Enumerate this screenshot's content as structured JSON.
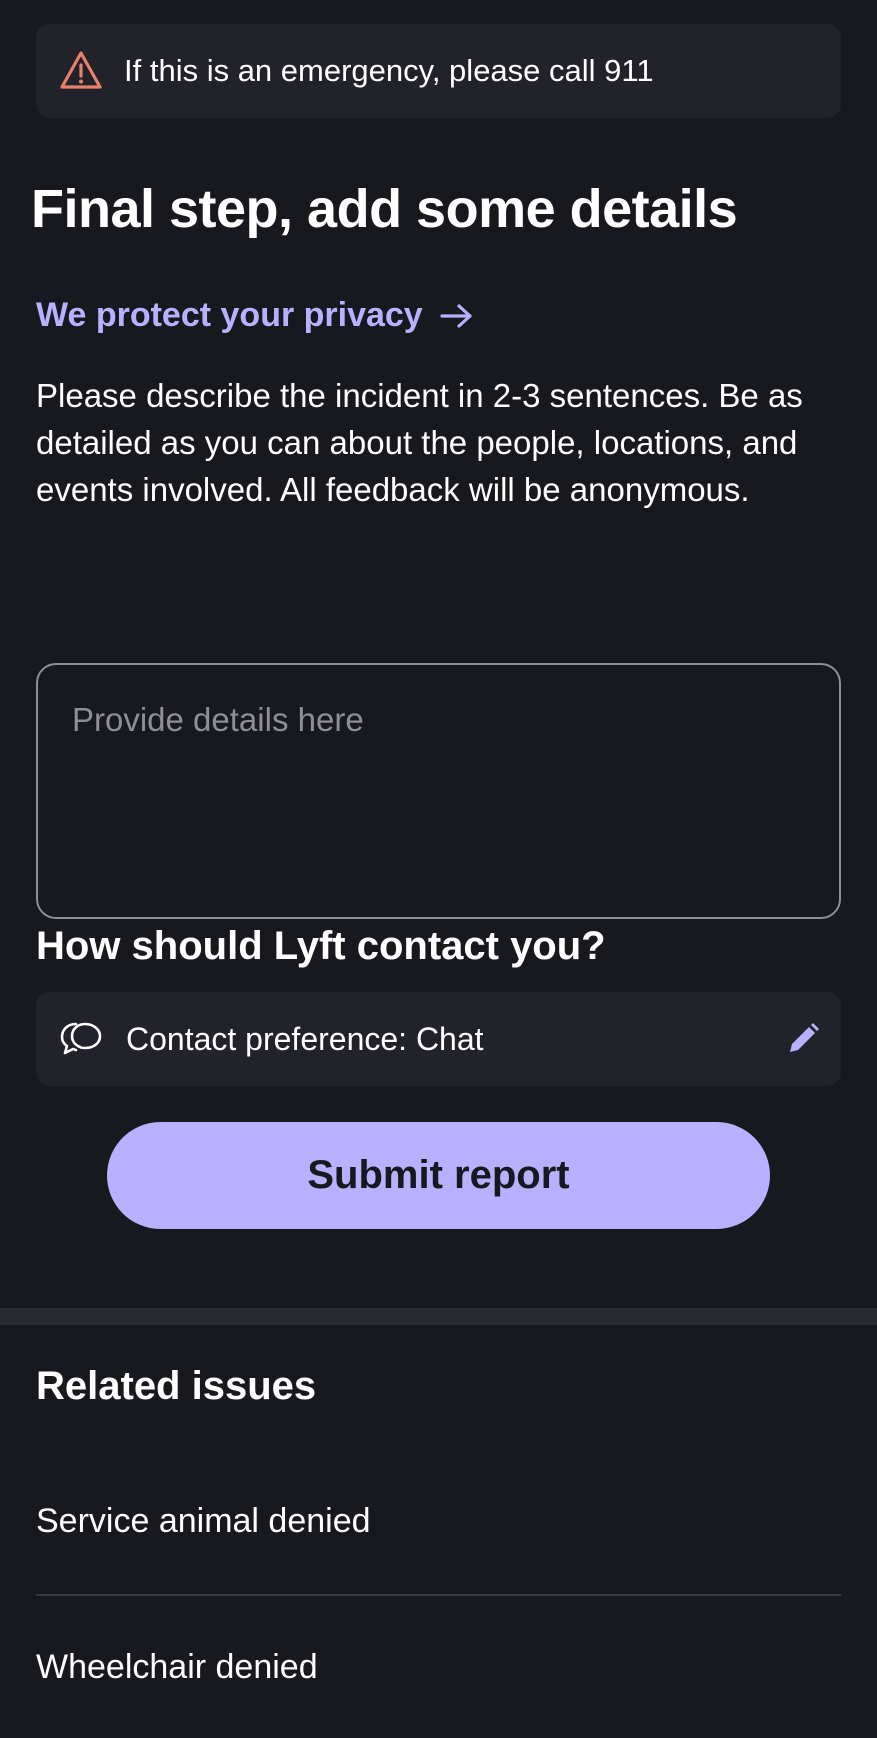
{
  "emergency": {
    "text": "If this is an emergency, please call 911",
    "icon": "warning-triangle-icon",
    "icon_color": "#e8806a"
  },
  "title": "Final step, add some details",
  "privacy_link": {
    "label": "We protect your privacy",
    "icon": "arrow-right-icon"
  },
  "description": "Please describe the incident in 2-3 sentences. Be as detailed as you can about the people, locations, and events involved. All feedback will be anonymous.",
  "details_input": {
    "placeholder": "Provide details here",
    "value": ""
  },
  "contact": {
    "heading": "How should Lyft contact you?",
    "preference_label": "Contact preference: Chat",
    "icon": "chat-bubbles-icon",
    "edit_icon": "pencil-icon"
  },
  "submit_label": "Submit report",
  "related": {
    "heading": "Related issues",
    "items": [
      {
        "label": "Service animal denied"
      },
      {
        "label": "Wheelchair denied"
      }
    ]
  },
  "colors": {
    "background": "#18181f",
    "card": "#22222b",
    "accent": "#b9b1ff",
    "warning": "#e8806a"
  }
}
